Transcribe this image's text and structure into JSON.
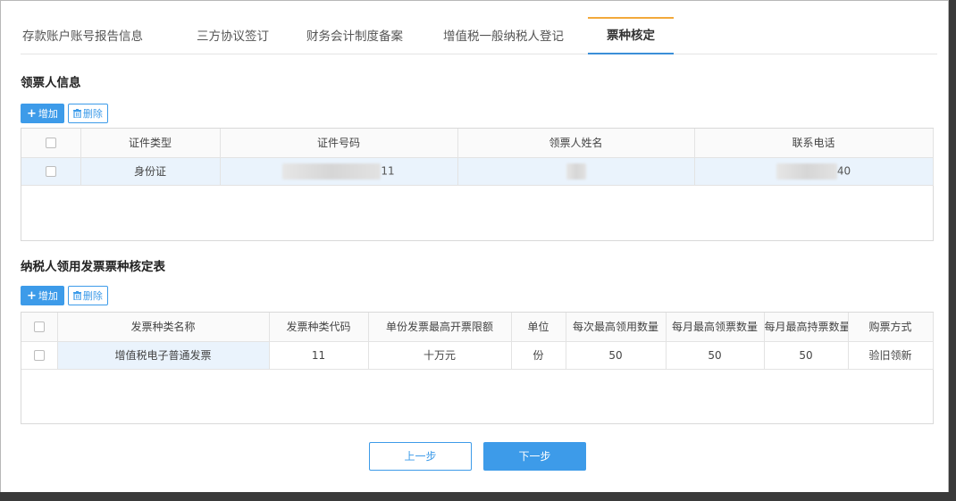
{
  "tabs": [
    {
      "label": "存款账户账号报告信息",
      "active": false
    },
    {
      "label": "三方协议签订",
      "active": false
    },
    {
      "label": "财务会计制度备案",
      "active": false
    },
    {
      "label": "增值税一般纳税人登记",
      "active": false
    },
    {
      "label": "票种核定",
      "active": true
    }
  ],
  "recipient_section": {
    "title": "领票人信息",
    "add_label": "增加",
    "delete_label": "删除",
    "columns": [
      "证件类型",
      "证件号码",
      "领票人姓名",
      "联系电话"
    ],
    "rows": [
      {
        "id_type": "身份证",
        "id_number_suffix": "11",
        "name": "",
        "phone_suffix": "40"
      }
    ]
  },
  "invoice_section": {
    "title": "纳税人领用发票票种核定表",
    "add_label": "增加",
    "delete_label": "删除",
    "columns": [
      "发票种类名称",
      "发票种类代码",
      "单份发票最高开票限额",
      "单位",
      "每次最高领用数量",
      "每月最高领票数量",
      "每月最高持票数量",
      "购票方式"
    ],
    "rows": [
      {
        "type_name": "增值税电子普通发票",
        "type_code": "11",
        "limit": "十万元",
        "unit": "份",
        "per_time": "50",
        "per_month": "50",
        "max_hold": "50",
        "method": "验旧领新"
      }
    ]
  },
  "footer": {
    "prev_label": "上一步",
    "next_label": "下一步"
  },
  "colors": {
    "accent": "#3d9be9",
    "tab_active_top": "#f2a93b",
    "row_selected": "#eaf3fc"
  },
  "icons": {
    "add": "plus-icon",
    "delete": "trash-icon",
    "checkbox": "checkbox-icon"
  }
}
